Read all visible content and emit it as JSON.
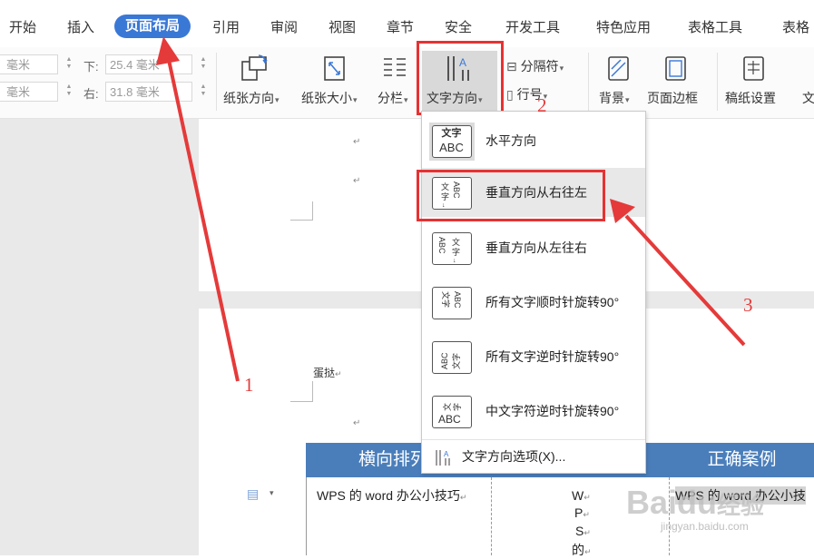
{
  "tabs": [
    {
      "label": "开始"
    },
    {
      "label": "插入"
    },
    {
      "label": "页面布局"
    },
    {
      "label": "引用"
    },
    {
      "label": "审阅"
    },
    {
      "label": "视图"
    },
    {
      "label": "章节"
    },
    {
      "label": "安全"
    },
    {
      "label": "开发工具"
    },
    {
      "label": "特色应用"
    },
    {
      "label": "表格工具"
    },
    {
      "label": "表格"
    }
  ],
  "active_tab": "页面布局",
  "margins": {
    "top_value": "毫米",
    "left_value": "毫米",
    "bottom_label": "下:",
    "bottom_value": "25.4 毫米",
    "right_label": "右:",
    "right_value": "31.8 毫米"
  },
  "ribbon": {
    "orientation": "纸张方向",
    "size": "纸张大小",
    "columns": "分栏",
    "text_direction": "文字方向",
    "separator": "分隔符",
    "line_number": "行号",
    "background": "背景",
    "page_border": "页面边框",
    "manuscript": "稿纸设置",
    "cut_label": "文"
  },
  "menu": {
    "items": [
      {
        "label": "水平方向",
        "icon_top": "文字",
        "icon_bottom": "ABC"
      },
      {
        "label": "垂直方向从右往左"
      },
      {
        "label": "垂直方向从左往右"
      },
      {
        "label": "所有文字顺时针旋转90°"
      },
      {
        "label": "所有文字逆时针旋转90°"
      },
      {
        "label": "中文字符逆时针旋转90°"
      }
    ],
    "options": "文字方向选项(X)..."
  },
  "document": {
    "para_text": "蛋挞",
    "table_header_left": "横向排列",
    "table_header_right": "正确案例",
    "cell_text": "WPS 的 word 办公小技巧",
    "vertical_chars": [
      "W",
      "P",
      "S",
      "的"
    ],
    "right_cell_text": "WPS 的 word 办公小技"
  },
  "annotations": {
    "n1": "1",
    "n2": "2",
    "n3": "3"
  },
  "watermark": {
    "brand": "Baidu",
    "brand_cn": "经验",
    "site": "jingyan.baidu.com"
  },
  "colors": {
    "accent": "#3a78d6",
    "highlight": "#e63232",
    "table_header": "#4a7ebb"
  }
}
